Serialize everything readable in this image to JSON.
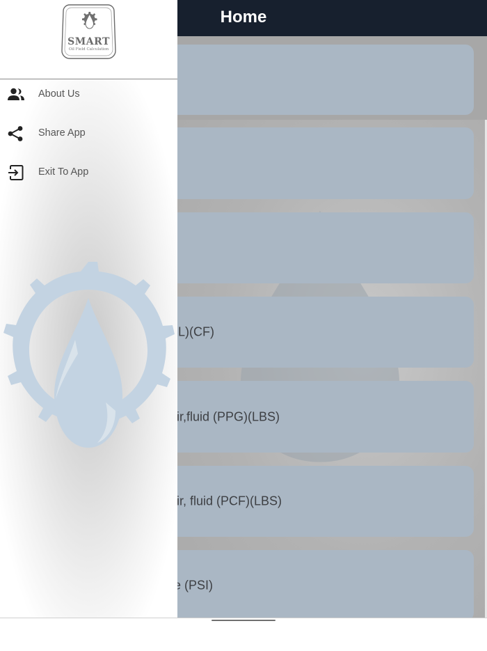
{
  "app": {
    "title": "Home"
  },
  "logo": {
    "title": "SMART",
    "subtitle": "Oil Field Calculation"
  },
  "drawer": {
    "items": [
      {
        "label": "About Us",
        "icon": "people-icon"
      },
      {
        "label": "Share App",
        "icon": "share-icon"
      },
      {
        "label": "Exit To App",
        "icon": "exit-to-app-icon"
      }
    ]
  },
  "cards": [
    {
      "label": ""
    },
    {
      "label": ""
    },
    {
      "label": ""
    },
    {
      "label": "BL)(CF)"
    },
    {
      "label": "air,fluid (PPG)(LBS)"
    },
    {
      "label": "air, fluid (PCF)(LBS)"
    },
    {
      "label": "re (PSI)"
    }
  ],
  "colors": {
    "header": "#17202e",
    "card": "#aab7c4",
    "watermark": "#c3d3e2"
  }
}
